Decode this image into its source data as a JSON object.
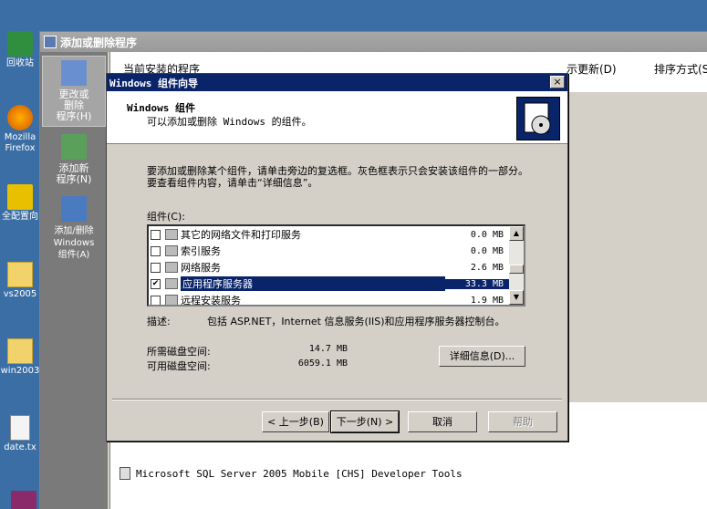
{
  "desktop": {
    "icons": [
      {
        "label": "回收站"
      },
      {
        "label": "Mozilla"
      },
      {
        "label": "Firefox"
      },
      {
        "label": "全配置向"
      },
      {
        "label": "vs2005"
      },
      {
        "label": "win2003"
      },
      {
        "label": "date.tx"
      }
    ]
  },
  "arp": {
    "title": "添加或删除程序",
    "sidebar": {
      "change_remove": "更改或\n删除\n程序(H)",
      "add_new": "添加新\n程序(N)",
      "add_remove_windows": "添加/删除\nWindows\n组件(A)"
    },
    "current_installed": "当前安装的程序",
    "show_updates": "示更新(D)",
    "sort_by": "排序方式(S",
    "program_row": "Microsoft SQL Server 2005 Mobile [CHS] Developer Tools"
  },
  "wizard": {
    "title": "Windows 组件向导",
    "close": "×",
    "header_title": "Windows 组件",
    "header_sub": "可以添加或删除 Windows 的组件。",
    "description": "要添加或删除某个组件，请单击旁边的复选框。灰色框表示只会安装该组件的一部分。要查看组件内容，请单击“详细信息”。",
    "components_label": "组件(C):",
    "components": [
      {
        "name": "其它的网络文件和打印服务",
        "size": "0.0 MB",
        "checked": false
      },
      {
        "name": "索引服务",
        "size": "0.0 MB",
        "checked": false
      },
      {
        "name": "网络服务",
        "size": "2.6 MB",
        "checked": false
      },
      {
        "name": "应用程序服务器",
        "size": "33.3 MB",
        "checked": true
      },
      {
        "name": "远程安装服务",
        "size": "1.9 MB",
        "checked": false
      }
    ],
    "desc_key": "描述:",
    "desc_value": "包括 ASP.NET，Internet 信息服务(IIS)和应用程序服务器控制台。",
    "required_space_key": "所需磁盘空间:",
    "required_space_value": "14.7 MB",
    "available_space_key": "可用磁盘空间:",
    "available_space_value": "6059.1 MB",
    "details_button": "详细信息(D)...",
    "back_button": "< 上一步(B)",
    "next_button": "下一步(N) >",
    "cancel_button": "取消",
    "help_button": "帮助"
  }
}
